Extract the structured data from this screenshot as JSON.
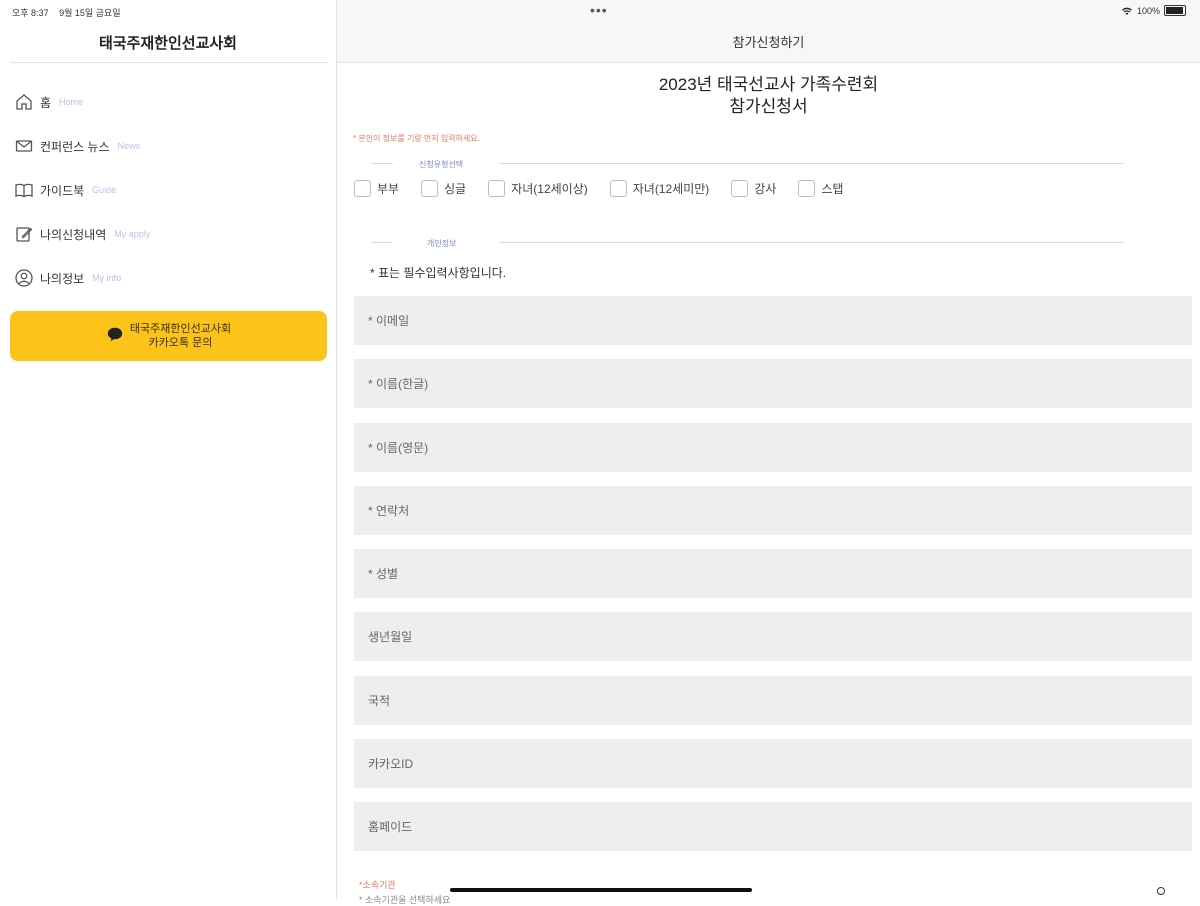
{
  "status": {
    "time": "오후 8:37",
    "date": "9월 15일 금요일",
    "battery": "100%",
    "dots": "•••"
  },
  "sidebar": {
    "title": "태국주재한인선교사회",
    "items": [
      {
        "label": "홈",
        "sub": "Home",
        "icon": "home-icon"
      },
      {
        "label": "컨퍼런스 뉴스",
        "sub": "News",
        "icon": "mail-icon"
      },
      {
        "label": "가이드북",
        "sub": "Guide",
        "icon": "book-icon"
      },
      {
        "label": "나의신청내역",
        "sub": "My apply",
        "icon": "edit-icon"
      },
      {
        "label": "나의정보",
        "sub": "My info",
        "icon": "user-icon"
      }
    ],
    "kakao": {
      "line1": "태국주재한인선교사회",
      "line2": "카카오톡 문의",
      "icon": "chat-bubble-icon",
      "color": "#fcc419"
    }
  },
  "main": {
    "page_title": "참가신청하기",
    "form_title_line1": "2023년 태국선교사 가족수련회",
    "form_title_line2": "참가신청서",
    "red_note": "* 본인이 정보를 기량 먼저 입력하세요.",
    "section1_label": "신청유형선택",
    "section2_label": "개인정보",
    "types": [
      "부부",
      "싱글",
      "자녀(12세이상)",
      "자녀(12세미만)",
      "강사",
      "스탭"
    ],
    "required_note": "* 표는 필수입력사항입니다.",
    "fields": [
      "* 이메일",
      "* 이름(한글)",
      "* 이름(영문)",
      "* 연락처",
      "* 성별",
      "생년월일",
      "국적",
      "카카오ID",
      "홈페이드"
    ],
    "sub_note_red": "*소속기관",
    "sub_note": "* 소속기관을 선택하세요"
  },
  "colors": {
    "accent": "#7a86d8",
    "warning": "#e57a5a",
    "field_bg": "#eeeeee"
  }
}
